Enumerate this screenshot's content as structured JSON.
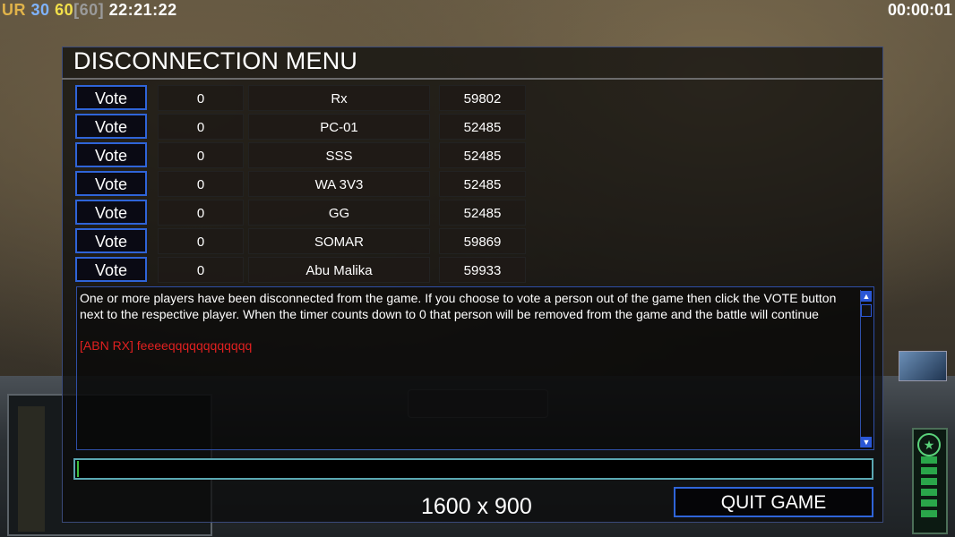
{
  "status_bar": {
    "ur": "UR",
    "fps": "30",
    "fps_target": "60",
    "fps_bracket": "[60]",
    "clock": "22:21:22",
    "game_timer": "00:00:01"
  },
  "menu": {
    "title": "DISCONNECTION MENU",
    "vote_label": "Vote",
    "players": [
      {
        "count": "0",
        "name": "Rx",
        "ping": "59802"
      },
      {
        "count": "0",
        "name": "PC-01",
        "ping": "52485"
      },
      {
        "count": "0",
        "name": "SSS",
        "ping": "52485"
      },
      {
        "count": "0",
        "name": "WA 3V3",
        "ping": "52485"
      },
      {
        "count": "0",
        "name": "GG",
        "ping": "52485"
      },
      {
        "count": "0",
        "name": "SOMAR",
        "ping": "59869"
      },
      {
        "count": "0",
        "name": "Abu Malika",
        "ping": "59933"
      }
    ],
    "message": "One or more players have been disconnected from the game. If you choose to vote a person out of the game then click the VOTE button next to the respective player. When the timer counts down to 0 that person will be removed from the game and the battle will continue",
    "chat_line": "[ABN   RX] feeeeqqqqqqqqqqqq",
    "chat_input_value": "",
    "resolution": "1600 x 900",
    "quit_label": "QUIT GAME"
  },
  "colors": {
    "accent_blue": "#2f64d8",
    "chat_red": "#e02020",
    "input_border": "#5aa7b2"
  }
}
